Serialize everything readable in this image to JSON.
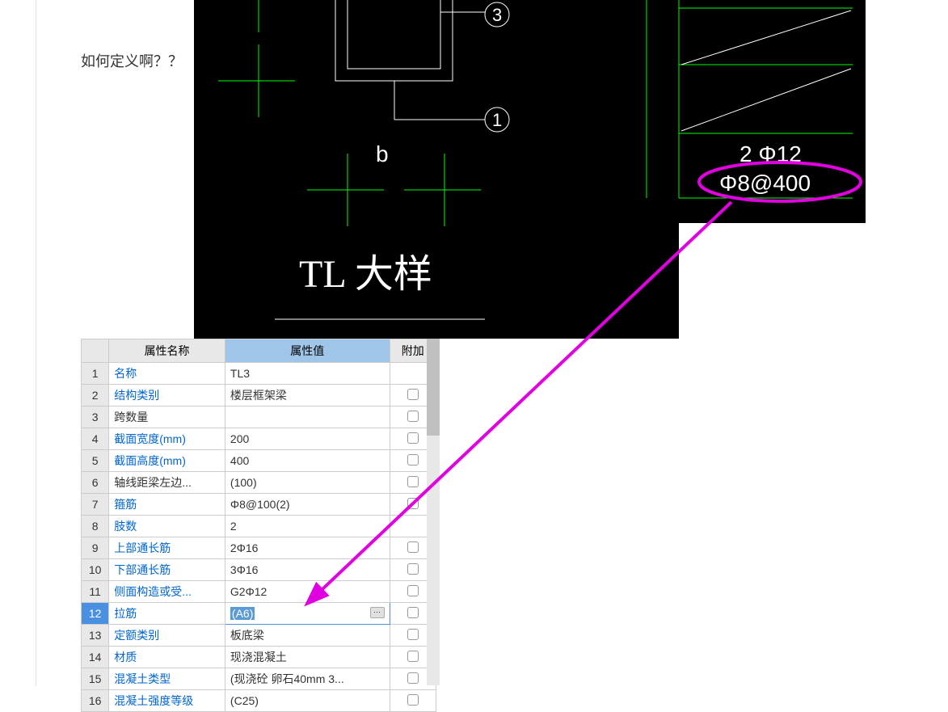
{
  "question": "如何定义啊？？",
  "cad": {
    "title_text": "TL 大样",
    "b_label": "b",
    "marker_3": "3",
    "marker_1": "1",
    "rebar_top": "2 Φ12",
    "rebar_highlight": "Φ8@400"
  },
  "table": {
    "headers": {
      "name": "属性名称",
      "value": "属性值",
      "extra": "附加"
    },
    "rows": [
      {
        "n": "1",
        "name": "名称",
        "value": "TL3",
        "link": true,
        "chk": false
      },
      {
        "n": "2",
        "name": "结构类别",
        "value": "楼层框架梁",
        "link": true,
        "chk": true
      },
      {
        "n": "3",
        "name": "跨数量",
        "value": "",
        "link": false,
        "chk": true
      },
      {
        "n": "4",
        "name": "截面宽度(mm)",
        "value": "200",
        "link": true,
        "chk": true
      },
      {
        "n": "5",
        "name": "截面高度(mm)",
        "value": "400",
        "link": true,
        "chk": true
      },
      {
        "n": "6",
        "name": "轴线距梁左边...",
        "value": "(100)",
        "link": false,
        "chk": true
      },
      {
        "n": "7",
        "name": "箍筋",
        "value": "Φ8@100(2)",
        "link": true,
        "chk": true
      },
      {
        "n": "8",
        "name": "肢数",
        "value": "2",
        "link": true,
        "chk": false
      },
      {
        "n": "9",
        "name": "上部通长筋",
        "value": "2Φ16",
        "link": true,
        "chk": true
      },
      {
        "n": "10",
        "name": "下部通长筋",
        "value": "3Φ16",
        "link": true,
        "chk": true
      },
      {
        "n": "11",
        "name": "侧面构造或受...",
        "value": "G2Φ12",
        "link": true,
        "chk": true
      },
      {
        "n": "12",
        "name": "拉筋",
        "value": "(A6)",
        "link": true,
        "chk": true,
        "selected": true
      },
      {
        "n": "13",
        "name": "定额类别",
        "value": "板底梁",
        "link": true,
        "chk": true
      },
      {
        "n": "14",
        "name": "材质",
        "value": "现浇混凝土",
        "link": true,
        "chk": true
      },
      {
        "n": "15",
        "name": "混凝土类型",
        "value": "(现浇砼 卵石40mm 3...",
        "link": true,
        "chk": true
      },
      {
        "n": "16",
        "name": "混凝土强度等级",
        "value": "(C25)",
        "link": true,
        "chk": true
      }
    ]
  }
}
